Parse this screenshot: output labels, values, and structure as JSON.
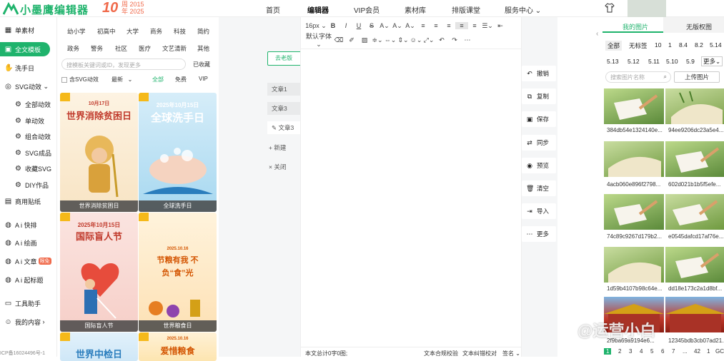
{
  "brand": {
    "name": "小墨鹰编辑器",
    "ten": "10",
    "anniv1": "周 2015",
    "anniv2": "年 2025"
  },
  "nav": [
    "首页",
    "编辑器",
    "VIP会员",
    "素材库",
    "排版课堂",
    "服务中心"
  ],
  "sidebar": [
    {
      "label": "单素材",
      "icon": "grid-icon"
    },
    {
      "label": "全文模板",
      "icon": "template-icon"
    },
    {
      "label": "洗手日",
      "icon": "hand-icon"
    },
    {
      "label": "SVG动效",
      "icon": "svg-icon"
    },
    {
      "label": "全部动效",
      "icon": "gear-icon"
    },
    {
      "label": "单动效",
      "icon": "gear-icon"
    },
    {
      "label": "组合动效",
      "icon": "gear-icon"
    },
    {
      "label": "SVG成品",
      "icon": "gear-icon"
    },
    {
      "label": "收藏SVG",
      "icon": "gear-icon"
    },
    {
      "label": "DIY作品",
      "icon": "gear-icon"
    },
    {
      "label": "商用贴纸",
      "icon": "sticker-icon"
    },
    {
      "label": "A i 快排",
      "icon": "ai-icon"
    },
    {
      "label": "A i 绘画",
      "icon": "ai-icon"
    },
    {
      "label": "A i 文章",
      "icon": "ai-icon",
      "badge": "限免"
    },
    {
      "label": "A i 起标题",
      "icon": "ai-icon"
    },
    {
      "label": "工具助手",
      "icon": "tool-icon"
    },
    {
      "label": "我的内容",
      "icon": "user-icon"
    }
  ],
  "icp": "ICP备16024496号-1",
  "categories": {
    "row1": [
      "幼小学",
      "初高中",
      "大学",
      "商务",
      "科技",
      "简约"
    ],
    "row2": [
      "政务",
      "警务",
      "社区",
      "医疗",
      "文艺清新",
      "其他"
    ]
  },
  "search": {
    "placeholder": "搜模板关键词或ID，发现更多",
    "collected": "已收藏"
  },
  "filters": {
    "svg": "含SVG动效",
    "sort": "最新",
    "all": "全部",
    "free": "免费",
    "vip": "VIP"
  },
  "templates": [
    {
      "date": "10月17日",
      "title": "世界消除贫困日",
      "caption": "世界消除贫困日"
    },
    {
      "date": "2025年10月15日",
      "title": "全球洗手日",
      "caption": "全球洗手日"
    },
    {
      "date": "2025年10月15日",
      "title": "国际盲人节",
      "caption": "国际盲人节"
    },
    {
      "date": "2025.10.16",
      "title": "节粮有我 不负“食”光",
      "caption": "世界粮食日"
    },
    {
      "date": "",
      "title": "世界中检日",
      "caption": ""
    },
    {
      "date": "2025.10.16",
      "title": "爱惜粮食",
      "caption": ""
    }
  ],
  "toolbar": {
    "fontsize": "16px",
    "font": "默认字体"
  },
  "docs": {
    "old": "去老版",
    "items": [
      "文章1",
      "文章3",
      "文章3"
    ],
    "new": "新建",
    "close": "关闭"
  },
  "footer": {
    "count": "本文总计0字0图;",
    "check": "文本合规校验",
    "fix": "文本纠错校对",
    "sign": "签名"
  },
  "actions": [
    "撤销",
    "复制",
    "保存",
    "同步",
    "预览",
    "清空",
    "导入",
    "更多"
  ],
  "images": {
    "tabs": [
      "我的图片",
      "无版权图"
    ],
    "chips1": [
      "全部",
      "无标签",
      "10",
      "1",
      "8.4",
      "8.2",
      "5.14"
    ],
    "chips2": [
      "5.13",
      "5.12",
      "5.11",
      "5.10",
      "5.9",
      "更多"
    ],
    "search": "搜索图片名称",
    "upload": "上传图片",
    "files": [
      "384db54e1324140e...",
      "94ee9206dc23a5e4...",
      "4acb060e896f2798...",
      "602d021b1b5f5efe...",
      "74c89c9267d179b2...",
      "e0545dafcd17af76e...",
      "1d59b4107b98c64e...",
      "dd18e173c2a1d8bf...",
      "2f9ba69a9194e6...",
      "12345bdb3cb07ad21..."
    ],
    "pages": [
      "1",
      "2",
      "3",
      "4",
      "5",
      "6",
      "7",
      "...",
      "42",
      "1",
      "GC"
    ]
  },
  "watermark": "@运营小白"
}
